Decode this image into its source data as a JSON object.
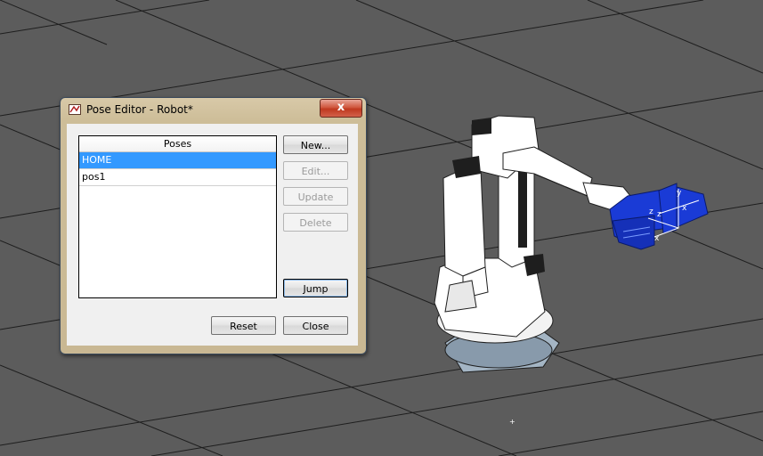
{
  "dialog": {
    "title": "Pose Editor - Robot*",
    "close_label": "x",
    "list_header": "Poses",
    "poses": [
      "HOME",
      "pos1"
    ],
    "selected_pose": "HOME",
    "buttons": {
      "new": "New...",
      "edit": "Edit...",
      "update": "Update",
      "delete": "Delete",
      "jump": "Jump",
      "reset": "Reset",
      "close": "Close"
    }
  },
  "scene": {
    "background_color": "#5c5c5c",
    "grid_color": "#000000",
    "robot_color": "#ffffff",
    "gripper_color": "#1a3bd6",
    "axis_labels": [
      "y",
      "z",
      "x",
      "z",
      "x"
    ]
  }
}
